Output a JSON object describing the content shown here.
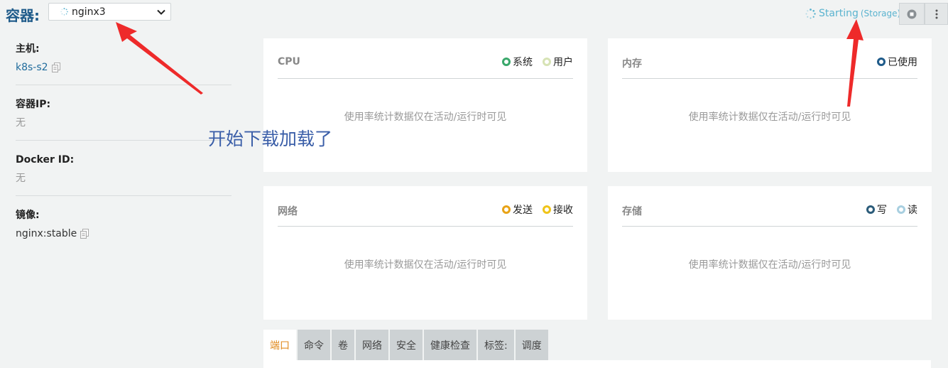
{
  "header": {
    "title": "容器:",
    "container_select": "nginx3",
    "status_text": "Starting",
    "status_sub": "(Storage)",
    "colors": {
      "accent": "#1f5b8a",
      "status": "#5ab3cf"
    }
  },
  "info": [
    {
      "label": "主机:",
      "value": "k8s-s2",
      "kind": "link",
      "copy": true
    },
    {
      "label": "容器IP:",
      "value": "无",
      "kind": "muted",
      "copy": false
    },
    {
      "label": "Docker ID:",
      "value": "无",
      "kind": "muted",
      "copy": false
    },
    {
      "label": "镜像:",
      "value": "nginx:stable",
      "kind": "dark",
      "copy": true
    }
  ],
  "annotation": "开始下载加载了",
  "cards": {
    "cpu": {
      "title": "CPU",
      "legend": [
        {
          "label": "系统",
          "color": "#3aa86b"
        },
        {
          "label": "用户",
          "color": "#d7e3b5"
        }
      ],
      "message": "使用率统计数据仅在活动/运行时可见"
    },
    "mem": {
      "title": "内存",
      "legend": [
        {
          "label": "已使用",
          "color": "#1f5b8a"
        }
      ],
      "message": "使用率统计数据仅在活动/运行时可见"
    },
    "net": {
      "title": "网络",
      "legend": [
        {
          "label": "发送",
          "color": "#e8a317"
        },
        {
          "label": "接收",
          "color": "#f0c419"
        }
      ],
      "message": "使用率统计数据仅在活动/运行时可见"
    },
    "disk": {
      "title": "存储",
      "legend": [
        {
          "label": "写",
          "color": "#2c5c7a"
        },
        {
          "label": "读",
          "color": "#a8cfe0"
        }
      ],
      "message": "使用率统计数据仅在活动/运行时可见"
    }
  },
  "tabs": [
    "端口",
    "命令",
    "卷",
    "网络",
    "安全",
    "健康检查",
    "标签:",
    "调度"
  ],
  "active_tab": 0
}
